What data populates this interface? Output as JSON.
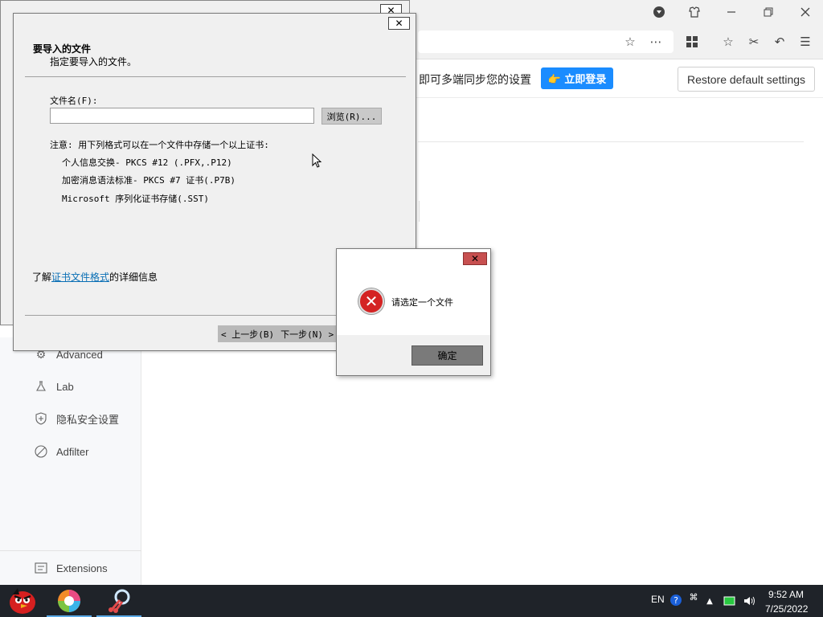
{
  "browser": {
    "sync_text": "即可多端同步您的设置",
    "login_label": "👉 立即登录",
    "restore_label": "Restore default settings",
    "window_icons": [
      "shield-icon",
      "shirt-icon",
      "minimize-icon",
      "restore-icon",
      "close-icon"
    ],
    "toolbar_icons": [
      "star-icon",
      "more-icon",
      "apps-icon",
      "favorites-icon",
      "scissors-icon",
      "undo-icon",
      "menu-icon"
    ]
  },
  "sidebar": {
    "items": [
      {
        "label": "Advanced",
        "icon": "advanced-icon"
      },
      {
        "label": "Lab",
        "icon": "flask-icon"
      },
      {
        "label": "隐私安全设置",
        "icon": "shield-plus-icon"
      },
      {
        "label": "Adfilter",
        "icon": "block-icon"
      },
      {
        "label": "Extensions",
        "icon": "extensions-icon"
      }
    ]
  },
  "wizard": {
    "title": "要导入的文件",
    "subtitle": "指定要导入的文件。",
    "file_label": "文件名(F):",
    "file_value": "",
    "browse_label": "浏览(R)...",
    "note": "注意: 用下列格式可以在一个文件中存储一个以上证书:",
    "formats": [
      "个人信息交换- PKCS #12 (.PFX,.P12)",
      "加密消息语法标准- PKCS #7 证书(.P7B)",
      "Microsoft 序列化证书存储(.SST)"
    ],
    "learn_prefix": "了解",
    "learn_link": "证书文件格式",
    "learn_suffix": "的详细信息",
    "back_label": "< 上一步(B)",
    "next_label": "下一步(N) >"
  },
  "error_dialog": {
    "message": "请选定一个文件",
    "ok_label": "确定"
  },
  "taskbar": {
    "apps": [
      "angry-birds-app",
      "color-wheel-app",
      "snipping-app"
    ],
    "language": "EN",
    "time": "9:52 AM",
    "date": "7/25/2022"
  }
}
